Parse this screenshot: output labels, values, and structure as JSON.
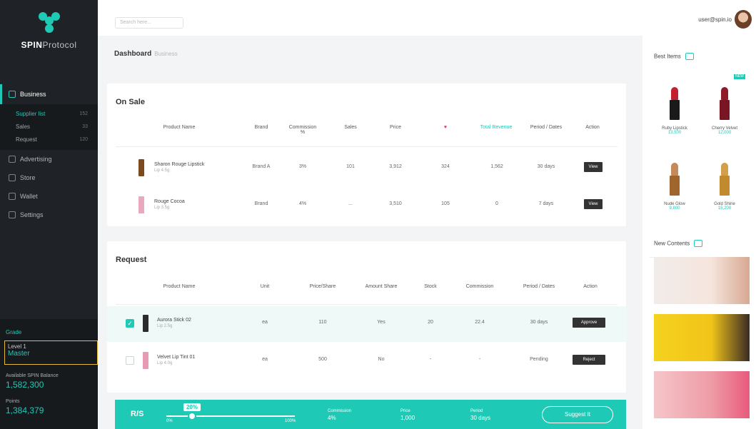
{
  "brand": {
    "bold": "SPIN",
    "light": "Protocol"
  },
  "nav": {
    "items": [
      "Business",
      "Advertising",
      "Store",
      "Wallet",
      "Settings"
    ],
    "sub": [
      {
        "label": "Supplier list",
        "count": "152"
      },
      {
        "label": "Sales",
        "count": "33"
      },
      {
        "label": "Request",
        "count": "120"
      }
    ]
  },
  "sidebar_bottom": {
    "grade_label": "Grade",
    "grade_title": "Level 1",
    "grade_value": "Master",
    "stat1_label": "Available SPIN Balance",
    "stat1_value": "1,582,300",
    "stat2_label": "Points",
    "stat2_value": "1,384,379"
  },
  "topbar": {
    "search_placeholder": "Search here...",
    "user_name": "user@spin.io"
  },
  "breadcrumb": {
    "title": "Dashboard",
    "sub": "Business"
  },
  "onsale": {
    "title": "On Sale",
    "headers": [
      "Product Name",
      "Brand",
      "Commission %",
      "Sales",
      "Price",
      "♥",
      "Total Revenue",
      "Period / Dates",
      "Action"
    ],
    "rows": [
      {
        "name": "Sharon Rouge Lipstick",
        "sub": "Lip 4.5g",
        "brand": "Brand A",
        "commission": "3%",
        "sales": "101",
        "price": "3,912",
        "likes": "324",
        "revenue": "1,562",
        "period": "30 days",
        "action": "View"
      },
      {
        "name": "Rouge Cocoa",
        "sub": "Lip 3.5g",
        "brand": "Brand",
        "commission": "4%",
        "sales": "...",
        "price": "3,510",
        "likes": "105",
        "revenue": "0",
        "period": "7 days",
        "action": "View"
      }
    ]
  },
  "request": {
    "title": "Request",
    "headers": [
      "Product Name",
      "Unit",
      "Price/Share",
      "Amount Share",
      "Stock",
      "Commission",
      "Period / Dates",
      "Action"
    ],
    "rows": [
      {
        "name": "Aurora Stick 02",
        "sub": "Lip 2.5g",
        "unit": "ea",
        "price": "110",
        "share": "Yes",
        "stock": "20",
        "commission": "22.4",
        "period": "30 days",
        "action": "Approve"
      },
      {
        "name": "Velvet Lip Tint 01",
        "sub": "Lip 4.0g",
        "unit": "ea",
        "price": "500",
        "share": "No",
        "stock": "-",
        "commission": "-",
        "period": "Pending",
        "action": "Reject"
      }
    ]
  },
  "bottom": {
    "rs": "R/S",
    "percent": "20%",
    "min": "0%",
    "max": "100%",
    "level": 0.2,
    "stats": [
      {
        "label": "Commission",
        "value": "4%"
      },
      {
        "label": "Price",
        "value": "1,000"
      },
      {
        "label": "Period",
        "value": "30 days"
      }
    ],
    "submit": "Suggest It"
  },
  "right": {
    "products_title": "Best Items",
    "products": [
      {
        "name": "Ruby Lipstick",
        "sub": "13,500",
        "color": "#c22030",
        "new": false
      },
      {
        "name": "Cherry Velvet",
        "sub": "12,000",
        "color": "#8d1b2a",
        "new": true
      },
      {
        "name": "Nude Glow",
        "sub": "9,800",
        "color": "#c58a5a",
        "new": false
      },
      {
        "name": "Gold Shine",
        "sub": "15,200",
        "color": "#d2a04a",
        "new": false
      }
    ],
    "new_label": "NEW",
    "contents_title": "New Contents"
  }
}
